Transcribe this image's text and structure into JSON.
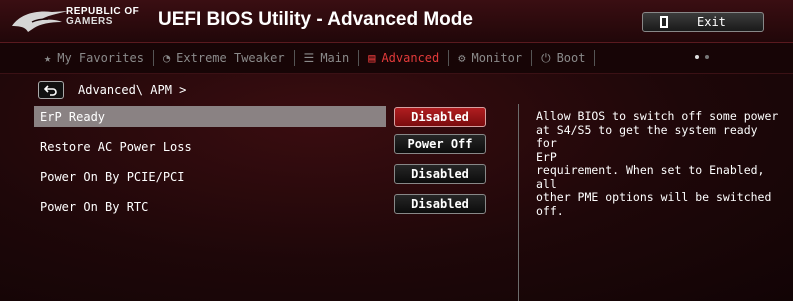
{
  "header": {
    "brand_line1": "REPUBLIC OF",
    "brand_line2": "GAMERS",
    "title": "UEFI BIOS Utility - Advanced Mode",
    "exit_label": "Exit"
  },
  "nav": {
    "items": [
      {
        "label": "My Favorites",
        "icon": "star-icon"
      },
      {
        "label": "Extreme Tweaker",
        "icon": "tweaker-icon"
      },
      {
        "label": "Main",
        "icon": "list-icon"
      },
      {
        "label": "Advanced",
        "icon": "advanced-icon",
        "active": true
      },
      {
        "label": "Monitor",
        "icon": "monitor-icon"
      },
      {
        "label": "Boot",
        "icon": "power-icon"
      }
    ],
    "page_dots": 2,
    "active_dot": 1
  },
  "breadcrumb": "Advanced\\ APM >",
  "settings": [
    {
      "label": "ErP Ready",
      "value": "Disabled",
      "selected": true
    },
    {
      "label": "Restore AC Power Loss",
      "value": "Power Off"
    },
    {
      "label": "Power On By PCIE/PCI",
      "value": "Disabled"
    },
    {
      "label": "Power On By RTC",
      "value": "Disabled"
    }
  ],
  "help_text": "Allow BIOS to switch off some power\nat S4/S5 to get the system ready for\nErP\nrequirement. When set to Enabled, all\nother PME options will be switched\noff.",
  "colors": {
    "accent_red": "#e23a3a",
    "selected_button": "#b01d20",
    "highlight_row": "#8a8283"
  }
}
